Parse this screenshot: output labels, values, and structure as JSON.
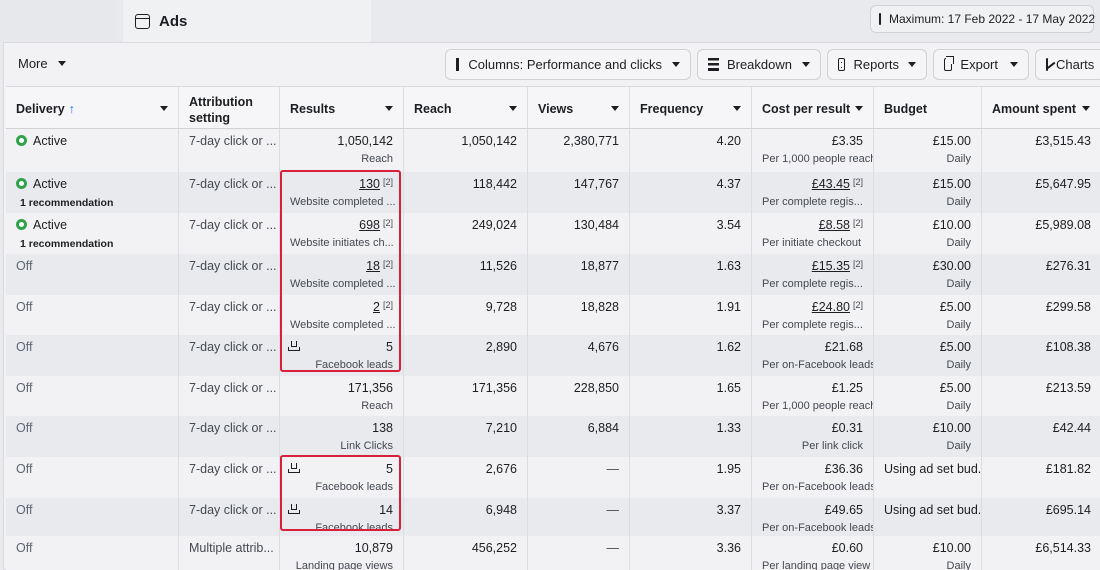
{
  "tabs": {
    "ads_title": "Ads"
  },
  "date_range": {
    "label": "Maximum: 17 Feb 2022 - 17 May 2022"
  },
  "toolbar": {
    "more": "More",
    "columns": "Columns: Performance and clicks",
    "breakdown": "Breakdown",
    "reports": "Reports",
    "export": "Export",
    "charts": "Charts"
  },
  "headers": {
    "delivery": "Delivery",
    "sort_arrow": "↑",
    "attribution": "Attribution setting",
    "results": "Results",
    "reach": "Reach",
    "views": "Views",
    "frequency": "Frequency",
    "cpr": "Cost per result",
    "budget": "Budget",
    "spent": "Amount spent"
  },
  "rows": [
    {
      "status": "Active",
      "rec": "",
      "attr": "7-day click or ...",
      "results": "1,050,142",
      "res_sup": "",
      "res_sub": "Reach",
      "lead": false,
      "reach": "1,050,142",
      "views": "2,380,771",
      "freq": "4.20",
      "cpr": "£3.35",
      "cpr_sup": "",
      "cpr_sub": "Per 1,000 people reach",
      "budget": "£15.00",
      "budget_sub": "Daily",
      "spent": "£3,515.43"
    },
    {
      "status": "Active",
      "rec": "1 recommendation",
      "attr": "7-day click or ...",
      "results": "130",
      "res_sup": "[2]",
      "res_sub": "Website completed ...",
      "lead": false,
      "reach": "118,442",
      "views": "147,767",
      "freq": "4.37",
      "cpr": "£43.45",
      "cpr_sup": "[2]",
      "cpr_sub": "Per complete regis...",
      "budget": "£15.00",
      "budget_sub": "Daily",
      "spent": "£5,647.95"
    },
    {
      "status": "Active",
      "rec": "1 recommendation",
      "attr": "7-day click or ...",
      "results": "698",
      "res_sup": "[2]",
      "res_sub": "Website initiates ch...",
      "lead": false,
      "reach": "249,024",
      "views": "130,484",
      "freq": "3.54",
      "cpr": "£8.58",
      "cpr_sup": "[2]",
      "cpr_sub": "Per initiate checkout",
      "budget": "£10.00",
      "budget_sub": "Daily",
      "spent": "£5,989.08"
    },
    {
      "status": "Off",
      "rec": "",
      "attr": "7-day click or ...",
      "results": "18",
      "res_sup": "[2]",
      "res_sub": "Website completed ...",
      "lead": false,
      "reach": "11,526",
      "views": "18,877",
      "freq": "1.63",
      "cpr": "£15.35",
      "cpr_sup": "[2]",
      "cpr_sub": "Per complete regis...",
      "budget": "£30.00",
      "budget_sub": "Daily",
      "spent": "£276.31"
    },
    {
      "status": "Off",
      "rec": "",
      "attr": "7-day click or ...",
      "results": "2",
      "res_sup": "[2]",
      "res_sub": "Website completed ...",
      "lead": false,
      "reach": "9,728",
      "views": "18,828",
      "freq": "1.91",
      "cpr": "£24.80",
      "cpr_sup": "[2]",
      "cpr_sub": "Per complete regis...",
      "budget": "£5.00",
      "budget_sub": "Daily",
      "spent": "£299.58"
    },
    {
      "status": "Off",
      "rec": "",
      "attr": "7-day click or ...",
      "results": "5",
      "res_sup": "",
      "res_sub": "Facebook leads",
      "lead": true,
      "reach": "2,890",
      "views": "4,676",
      "freq": "1.62",
      "cpr": "£21.68",
      "cpr_sup": "",
      "cpr_sub": "Per on-Facebook leads",
      "budget": "£5.00",
      "budget_sub": "Daily",
      "spent": "£108.38"
    },
    {
      "status": "Off",
      "rec": "",
      "attr": "7-day click or ...",
      "results": "171,356",
      "res_sup": "",
      "res_sub": "Reach",
      "lead": false,
      "reach": "171,356",
      "views": "228,850",
      "freq": "1.65",
      "cpr": "£1.25",
      "cpr_sup": "",
      "cpr_sub": "Per 1,000 people reach",
      "budget": "£5.00",
      "budget_sub": "Daily",
      "spent": "£213.59"
    },
    {
      "status": "Off",
      "rec": "",
      "attr": "7-day click or ...",
      "results": "138",
      "res_sup": "",
      "res_sub": "Link Clicks",
      "lead": false,
      "reach": "7,210",
      "views": "6,884",
      "freq": "1.33",
      "cpr": "£0.31",
      "cpr_sup": "",
      "cpr_sub": "Per link click",
      "budget": "£10.00",
      "budget_sub": "Daily",
      "spent": "£42.44"
    },
    {
      "status": "Off",
      "rec": "",
      "attr": "7-day click or ...",
      "results": "5",
      "res_sup": "",
      "res_sub": "Facebook leads",
      "lead": true,
      "reach": "2,676",
      "views": "—",
      "freq": "1.95",
      "cpr": "£36.36",
      "cpr_sup": "",
      "cpr_sub": "Per on-Facebook leads",
      "budget": "Using ad set bud...",
      "budget_sub": "",
      "spent": "£181.82"
    },
    {
      "status": "Off",
      "rec": "",
      "attr": "7-day click or ...",
      "results": "14",
      "res_sup": "",
      "res_sub": "Facebook leads",
      "lead": true,
      "reach": "6,948",
      "views": "—",
      "freq": "3.37",
      "cpr": "£49.65",
      "cpr_sup": "",
      "cpr_sub": "Per on-Facebook leads",
      "budget": "Using ad set bud...",
      "budget_sub": "",
      "spent": "£695.14"
    },
    {
      "status": "Off",
      "rec": "",
      "attr": "Multiple attrib...",
      "results": "10,879",
      "res_sup": "",
      "res_sub": "Landing page views",
      "lead": false,
      "reach": "456,252",
      "views": "—",
      "freq": "3.36",
      "cpr": "£0.60",
      "cpr_sup": "",
      "cpr_sub": "Per landing page view",
      "budget": "£10.00",
      "budget_sub": "Daily",
      "spent": "£6,514.33"
    }
  ]
}
